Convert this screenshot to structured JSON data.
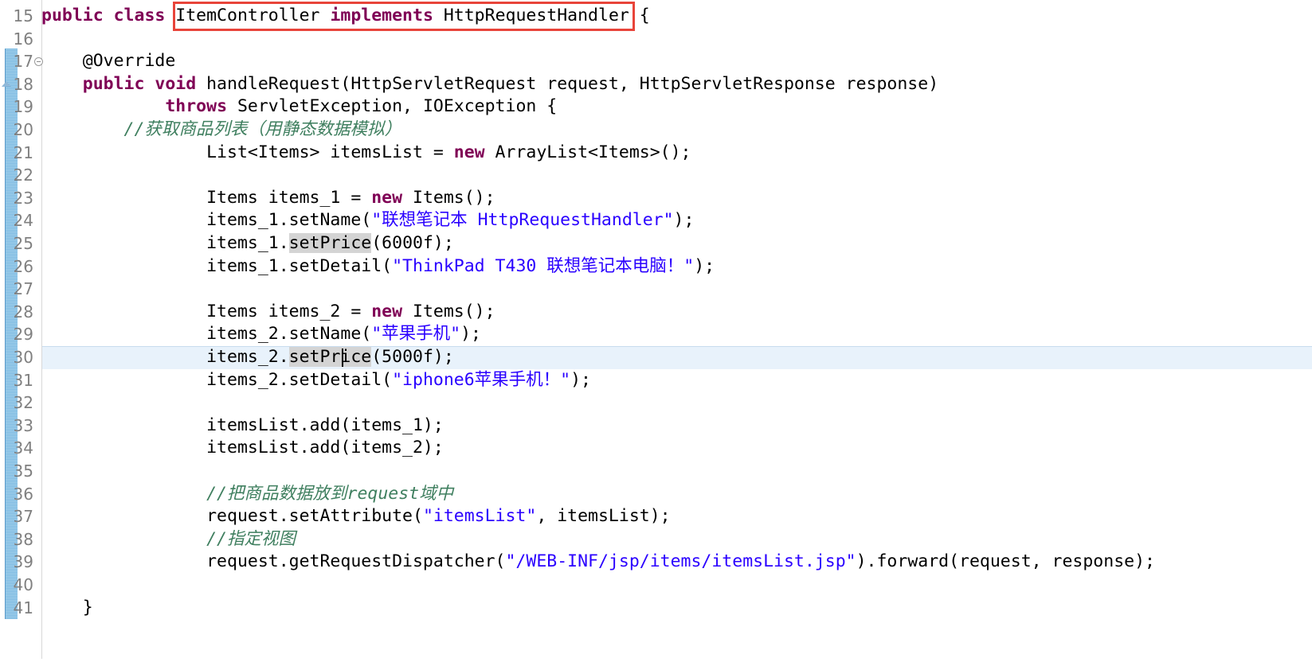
{
  "editor": {
    "kind": "java-source-editor",
    "colors": {
      "background": "#ffffff",
      "keyword": "#7f0055",
      "string": "#2a00ff",
      "comment": "#3f7f5f",
      "line_number": "#808080",
      "current_line": "#e8f2fb",
      "occurrence_highlight": "#d4d4d4",
      "annotation_box": "#e8443a",
      "change_bar": "#75b6e0"
    },
    "first_line_number": 15,
    "last_line_number": 41,
    "current_line_number": 30,
    "folding_marker_line": 17,
    "change_bar_range": [
      17,
      41
    ]
  },
  "annotations": {
    "red_box_text": "ItemController implements HttpRequestHandler"
  },
  "gutter": {
    "line_numbers": [
      "15",
      "16",
      "17",
      "18",
      "19",
      "20",
      "21",
      "22",
      "23",
      "24",
      "25",
      "26",
      "27",
      "28",
      "29",
      "30",
      "31",
      "32",
      "33",
      "34",
      "35",
      "36",
      "37",
      "38",
      "39",
      "40",
      "41"
    ]
  },
  "code": {
    "lines": [
      {
        "n": "15",
        "tokens": [
          {
            "t": "kw",
            "s": "public class "
          },
          {
            "t": "plain",
            "s": "ItemController "
          },
          {
            "t": "kw",
            "s": "implements "
          },
          {
            "t": "plain",
            "s": "HttpRequestHandler {"
          }
        ]
      },
      {
        "n": "16",
        "tokens": []
      },
      {
        "n": "17",
        "tokens": [
          {
            "t": "plain",
            "s": "    @Override"
          }
        ]
      },
      {
        "n": "18",
        "tokens": [
          {
            "t": "kw",
            "s": "    public void "
          },
          {
            "t": "plain",
            "s": "handleRequest(HttpServletRequest request, HttpServletResponse response)"
          }
        ]
      },
      {
        "n": "19",
        "tokens": [
          {
            "t": "plain",
            "s": "            "
          },
          {
            "t": "kw",
            "s": "throws "
          },
          {
            "t": "plain",
            "s": "ServletException, IOException {"
          }
        ]
      },
      {
        "n": "20",
        "tokens": [
          {
            "t": "cmt",
            "s": "        //获取商品列表（用静态数据模拟）"
          }
        ]
      },
      {
        "n": "21",
        "tokens": [
          {
            "t": "plain",
            "s": "                List<Items> itemsList = "
          },
          {
            "t": "kw",
            "s": "new "
          },
          {
            "t": "plain",
            "s": "ArrayList<Items>();"
          }
        ]
      },
      {
        "n": "22",
        "tokens": []
      },
      {
        "n": "23",
        "tokens": [
          {
            "t": "plain",
            "s": "                Items items_1 = "
          },
          {
            "t": "kw",
            "s": "new "
          },
          {
            "t": "plain",
            "s": "Items();"
          }
        ]
      },
      {
        "n": "24",
        "tokens": [
          {
            "t": "plain",
            "s": "                items_1.setName("
          },
          {
            "t": "str",
            "s": "\"联想笔记本 HttpRequestHandler\""
          },
          {
            "t": "plain",
            "s": ");"
          }
        ]
      },
      {
        "n": "25",
        "tokens": [
          {
            "t": "plain",
            "s": "                items_1."
          },
          {
            "t": "occ",
            "s": "setPrice"
          },
          {
            "t": "plain",
            "s": "(6000f);"
          }
        ]
      },
      {
        "n": "26",
        "tokens": [
          {
            "t": "plain",
            "s": "                items_1.setDetail("
          },
          {
            "t": "str",
            "s": "\"ThinkPad T430 联想笔记本电脑！\""
          },
          {
            "t": "plain",
            "s": ");"
          }
        ]
      },
      {
        "n": "27",
        "tokens": []
      },
      {
        "n": "28",
        "tokens": [
          {
            "t": "plain",
            "s": "                Items items_2 = "
          },
          {
            "t": "kw",
            "s": "new "
          },
          {
            "t": "plain",
            "s": "Items();"
          }
        ]
      },
      {
        "n": "29",
        "tokens": [
          {
            "t": "plain",
            "s": "                items_2.setName("
          },
          {
            "t": "str",
            "s": "\"苹果手机\""
          },
          {
            "t": "plain",
            "s": ");"
          }
        ]
      },
      {
        "n": "30",
        "tokens": [
          {
            "t": "plain",
            "s": "                items_2."
          },
          {
            "t": "occ",
            "s": "setPrice"
          },
          {
            "t": "plain",
            "s": "(5000f);"
          }
        ]
      },
      {
        "n": "31",
        "tokens": [
          {
            "t": "plain",
            "s": "                items_2.setDetail("
          },
          {
            "t": "str",
            "s": "\"iphone6苹果手机！\""
          },
          {
            "t": "plain",
            "s": ");"
          }
        ]
      },
      {
        "n": "32",
        "tokens": []
      },
      {
        "n": "33",
        "tokens": [
          {
            "t": "plain",
            "s": "                itemsList.add(items_1);"
          }
        ]
      },
      {
        "n": "34",
        "tokens": [
          {
            "t": "plain",
            "s": "                itemsList.add(items_2);"
          }
        ]
      },
      {
        "n": "35",
        "tokens": []
      },
      {
        "n": "36",
        "tokens": [
          {
            "t": "cmt",
            "s": "                //把商品数据放到request域中"
          }
        ]
      },
      {
        "n": "37",
        "tokens": [
          {
            "t": "plain",
            "s": "                request.setAttribute("
          },
          {
            "t": "str",
            "s": "\"itemsList\""
          },
          {
            "t": "plain",
            "s": ", itemsList);"
          }
        ]
      },
      {
        "n": "38",
        "tokens": [
          {
            "t": "cmt",
            "s": "                //指定视图"
          }
        ]
      },
      {
        "n": "39",
        "tokens": [
          {
            "t": "plain",
            "s": "                request.getRequestDispatcher("
          },
          {
            "t": "str",
            "s": "\"/WEB-INF/jsp/items/itemsList.jsp\""
          },
          {
            "t": "plain",
            "s": ").forward(request, response);"
          }
        ]
      },
      {
        "n": "40",
        "tokens": []
      },
      {
        "n": "41",
        "tokens": [
          {
            "t": "plain",
            "s": "    }"
          }
        ]
      }
    ]
  }
}
